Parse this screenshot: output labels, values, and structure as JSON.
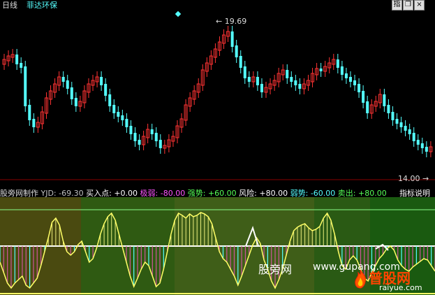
{
  "header": {
    "period_label": "日线",
    "stock_name": "菲达环保",
    "btn_indicator": "指",
    "btn_restore": "❐",
    "btn_close": "×"
  },
  "main_chart": {
    "high_label": "19.69",
    "low_label": "14.00"
  },
  "indicator_bar": {
    "source": "股旁网制作",
    "items": [
      {
        "key": "yjd",
        "label": "YJD:",
        "value": "-69.30",
        "color": "#c0c0c0"
      },
      {
        "key": "buy",
        "label": "买入点:",
        "value": "+0.00",
        "color": "#ffffff"
      },
      {
        "key": "weak",
        "label": "极弱:",
        "value": "-80.00",
        "color": "#ff55ff"
      },
      {
        "key": "strong",
        "label": "强势:",
        "value": "+60.00",
        "color": "#55ff55"
      },
      {
        "key": "risk",
        "label": "风险:",
        "value": "+80.00",
        "color": "#ffffff"
      },
      {
        "key": "weak2",
        "label": "弱势:",
        "value": "-60.00",
        "color": "#55ffff"
      },
      {
        "key": "sell",
        "label": "卖出:",
        "value": "+80.00",
        "color": "#55ff55"
      }
    ],
    "help_label": "指标说明"
  },
  "watermark": {
    "site_cn": "股旁网",
    "site_url": "www.gupang.com",
    "logo_text": "普股网",
    "logo_url": "raiyue.com"
  },
  "colors": {
    "up": "#ff3333",
    "down": "#54ffff",
    "axis": "#aa0000",
    "yellow_line": "#ffff66"
  }
}
